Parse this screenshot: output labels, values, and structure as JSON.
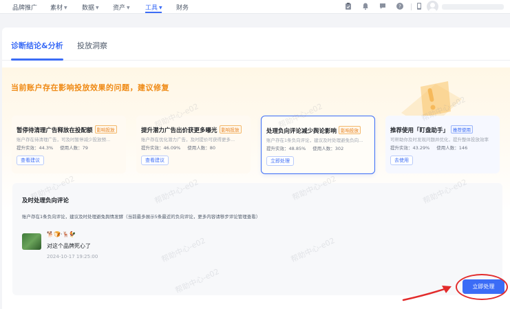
{
  "topnav": {
    "items": [
      {
        "label": "品牌推广",
        "has_caret": false
      },
      {
        "label": "素材",
        "has_caret": true
      },
      {
        "label": "数据",
        "has_caret": true
      },
      {
        "label": "资产",
        "has_caret": true
      },
      {
        "label": "工具",
        "has_caret": true,
        "active": true
      },
      {
        "label": "财务",
        "has_caret": false
      }
    ],
    "icons": [
      "clipboard-icon",
      "bell-icon",
      "message-icon",
      "help-icon",
      "mobile-icon"
    ]
  },
  "tabs": [
    {
      "label": "诊断结论&分析",
      "active": true
    },
    {
      "label": "投放洞察",
      "active": false
    }
  ],
  "banner": {
    "title": "当前账户存在影响投放效果的问题，建议修复"
  },
  "cards": [
    {
      "title": "暂停待清理广告释放在投配额",
      "tag": "影响投放",
      "tag_color": "orange",
      "desc": "账户存在待清理广告，可及时暂停减少投放预...",
      "stat1_label": "提升实效：",
      "stat1_value": "44.3%",
      "stat2_label": "使用人数：",
      "stat2_value": "79",
      "button": "查看建议",
      "selected": false
    },
    {
      "title": "提升潜力广告出价获更多曝光",
      "tag": "影响投放",
      "tag_color": "orange",
      "desc": "账户存在优化潜力广告，及时提价可获得更多...",
      "stat1_label": "提升实效：",
      "stat1_value": "46.09%",
      "stat2_label": "使用人数：",
      "stat2_value": "80",
      "button": "查看建议",
      "selected": false
    },
    {
      "title": "处理负向评论减少舆论影响",
      "tag": "影响投放",
      "tag_color": "orange",
      "desc": "账户存在1条负向评论，建议及时处理避免负向...",
      "stat1_label": "提升实效：",
      "stat1_value": "48.85%",
      "stat2_label": "使用人数：",
      "stat2_value": "302",
      "button": "立即处理",
      "selected": true
    },
    {
      "title": "推荐使用「盯盘助手」",
      "tag": "推荐使用",
      "tag_color": "blue",
      "desc": "可帮助你及时发现问题并优化，提升整体投放效率",
      "stat1_label": "提升实效：",
      "stat1_value": "43.29%",
      "stat2_label": "使用人数：",
      "stat2_value": "146",
      "button": "去使用",
      "selected": false
    }
  ],
  "detail": {
    "title": "及时处理负向评论",
    "desc": "账户存在1条负向评论，建议及时处理避免舆情发酵（当前最多展示5条最近的负向评论，更多内容请移步评论管理查看）",
    "comment": {
      "user": "🐕🍞·🦌🐓",
      "text": "对这个品牌死心了",
      "time": "2024-10-17 19:25:00"
    }
  },
  "action_button": "立即处理",
  "watermark": "帮助中心-e02",
  "colors": {
    "primary": "#3b6cf6",
    "warning": "#ef8a15",
    "annotation_red": "#e22b2b"
  }
}
